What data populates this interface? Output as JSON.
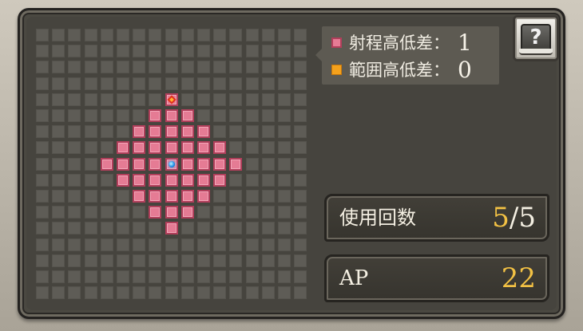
{
  "grid": {
    "cols": 17,
    "rows": 17,
    "center": [
      8,
      8
    ],
    "range_radius": 4,
    "target": [
      8,
      4
    ]
  },
  "legend": {
    "range_label": "射程高低差：",
    "range_value": "1",
    "area_label": "範囲高低差：",
    "area_value": "0",
    "range_color": "#e57b94",
    "area_color": "#f4a11c"
  },
  "help_button": {
    "icon": "help-book-icon",
    "glyph": "?"
  },
  "uses": {
    "label": "使用回数",
    "current": "5",
    "separator": "/",
    "max": "5"
  },
  "ap": {
    "label": "AP",
    "value": "22"
  },
  "colors": {
    "panel": "#4a4841",
    "value_gold": "#f2c144"
  }
}
